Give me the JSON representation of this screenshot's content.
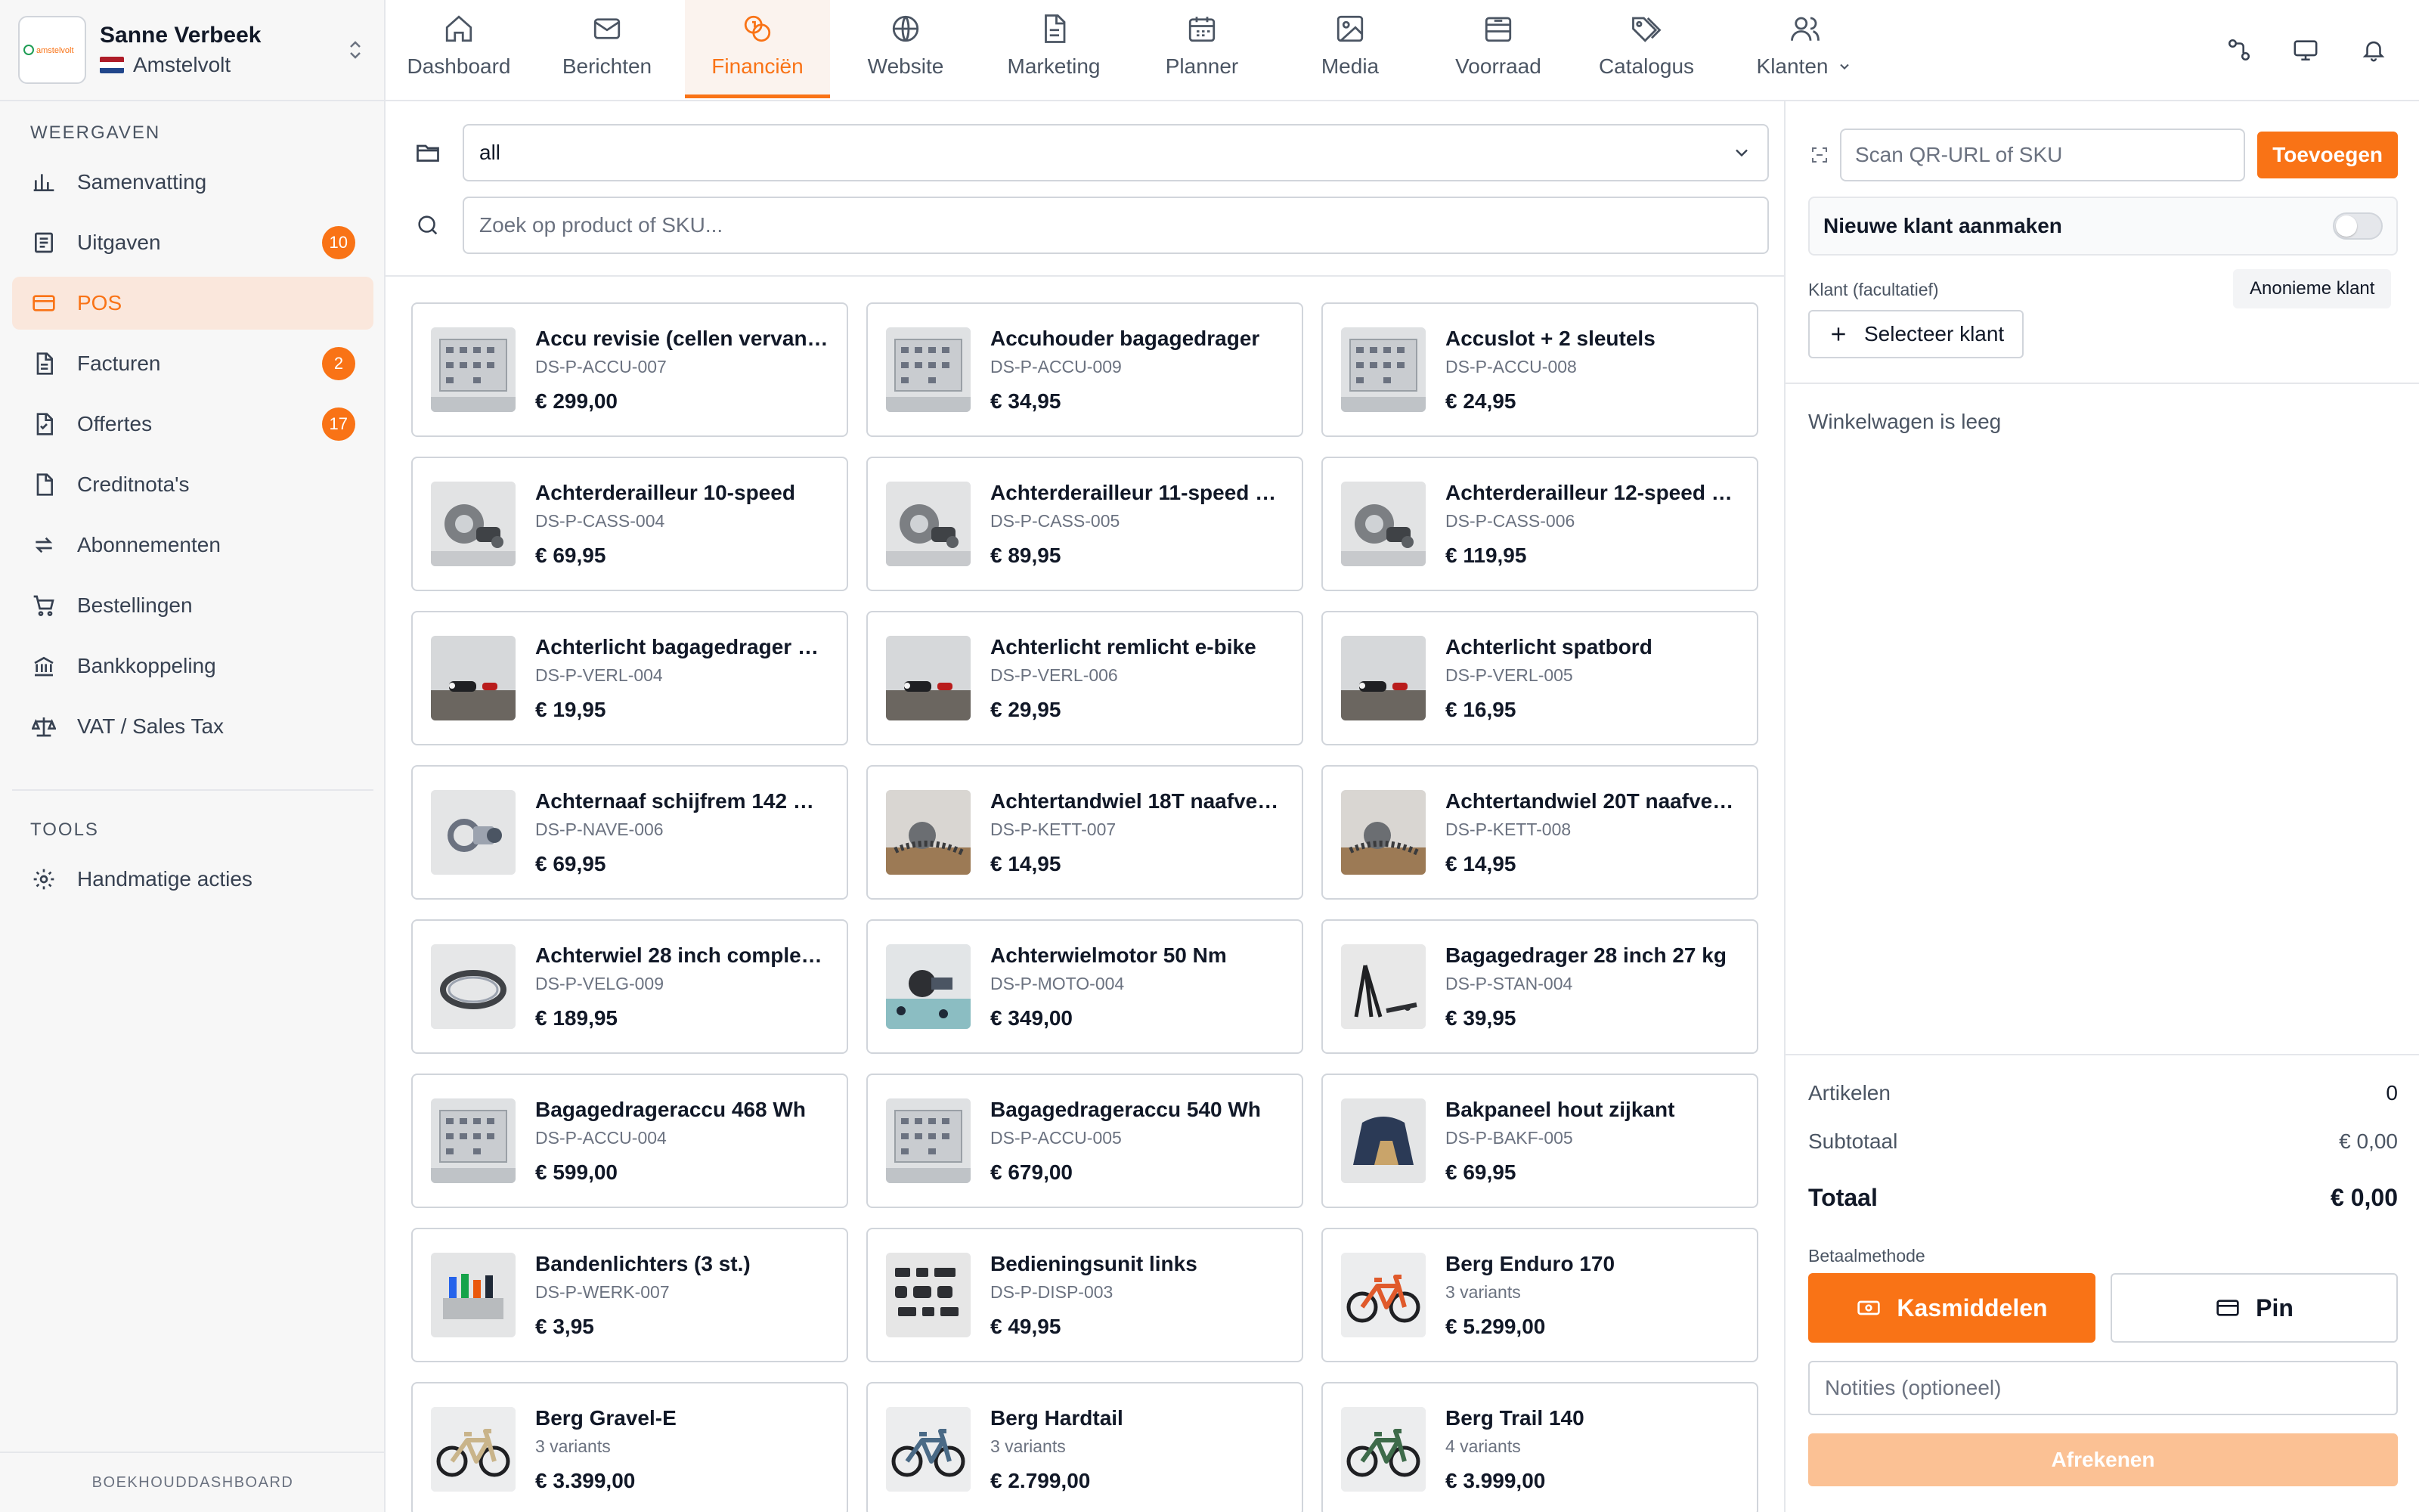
{
  "account": {
    "name": "Sanne Verbeek",
    "company": "Amstelvolt",
    "logo_text": "amstelvolt"
  },
  "sidebar": {
    "section_views": "WEERGAVEN",
    "items": [
      {
        "label": "Samenvatting",
        "icon": "bar-chart-icon",
        "badge": ""
      },
      {
        "label": "Uitgaven",
        "icon": "receipt-icon",
        "badge": "10"
      },
      {
        "label": "POS",
        "icon": "credit-card-icon",
        "badge": ""
      },
      {
        "label": "Facturen",
        "icon": "document-icon",
        "badge": "2"
      },
      {
        "label": "Offertes",
        "icon": "quote-document-icon",
        "badge": "17"
      },
      {
        "label": "Creditnota's",
        "icon": "credit-note-icon",
        "badge": ""
      },
      {
        "label": "Abonnementen",
        "icon": "repeat-icon",
        "badge": ""
      },
      {
        "label": "Bestellingen",
        "icon": "cart-icon",
        "badge": ""
      },
      {
        "label": "Bankkoppeling",
        "icon": "bank-icon",
        "badge": ""
      },
      {
        "label": "VAT / Sales Tax",
        "icon": "scales-icon",
        "badge": ""
      }
    ],
    "section_tools": "TOOLS",
    "tools": [
      {
        "label": "Handmatige acties",
        "icon": "gear-icon"
      }
    ],
    "footer": "BOEKHOUDDASHBOARD"
  },
  "topnav": {
    "tabs": [
      {
        "label": "Dashboard",
        "icon": "home-icon"
      },
      {
        "label": "Berichten",
        "icon": "mail-icon"
      },
      {
        "label": "Financiën",
        "icon": "coins-icon"
      },
      {
        "label": "Website",
        "icon": "globe-icon"
      },
      {
        "label": "Marketing",
        "icon": "document-icon"
      },
      {
        "label": "Planner",
        "icon": "calendar-icon"
      },
      {
        "label": "Media",
        "icon": "image-icon"
      },
      {
        "label": "Voorraad",
        "icon": "archive-icon"
      },
      {
        "label": "Catalogus",
        "icon": "tags-icon"
      },
      {
        "label": "Klanten",
        "icon": "users-icon"
      }
    ]
  },
  "pos": {
    "folder_select": "all",
    "search_placeholder": "Zoek op product of SKU...",
    "products": [
      {
        "name": "Accu revisie (cellen vervange...",
        "sub": "DS-P-ACCU-007",
        "price": "€ 299,00",
        "img": "rack"
      },
      {
        "name": "Accuhouder bagagedrager",
        "sub": "DS-P-ACCU-009",
        "price": "€ 34,95",
        "img": "rack"
      },
      {
        "name": "Accuslot + 2 sleutels",
        "sub": "DS-P-ACCU-008",
        "price": "€ 24,95",
        "img": "rack"
      },
      {
        "name": "Achterderailleur 10-speed",
        "sub": "DS-P-CASS-004",
        "price": "€ 69,95",
        "img": "gear"
      },
      {
        "name": "Achterderailleur 11-speed e-...",
        "sub": "DS-P-CASS-005",
        "price": "€ 89,95",
        "img": "gear"
      },
      {
        "name": "Achterderailleur 12-speed e-...",
        "sub": "DS-P-CASS-006",
        "price": "€ 119,95",
        "img": "gear"
      },
      {
        "name": "Achterlicht bagagedrager 50...",
        "sub": "DS-P-VERL-004",
        "price": "€ 19,95",
        "img": "light"
      },
      {
        "name": "Achterlicht remlicht e-bike",
        "sub": "DS-P-VERL-006",
        "price": "€ 29,95",
        "img": "light"
      },
      {
        "name": "Achterlicht spatbord",
        "sub": "DS-P-VERL-005",
        "price": "€ 16,95",
        "img": "light"
      },
      {
        "name": "Achternaaf schijfrem 142 mm",
        "sub": "DS-P-NAVE-006",
        "price": "€ 69,95",
        "img": "hub"
      },
      {
        "name": "Achtertandwiel 18T naafvers...",
        "sub": "DS-P-KETT-007",
        "price": "€ 14,95",
        "img": "chain"
      },
      {
        "name": "Achtertandwiel 20T naafvers...",
        "sub": "DS-P-KETT-008",
        "price": "€ 14,95",
        "img": "chain"
      },
      {
        "name": "Achterwiel 28 inch compleet...",
        "sub": "DS-P-VELG-009",
        "price": "€ 189,95",
        "img": "rim"
      },
      {
        "name": "Achterwielmotor 50 Nm",
        "sub": "DS-P-MOTO-004",
        "price": "€ 349,00",
        "img": "motor"
      },
      {
        "name": "Bagagedrager 28 inch 27 kg",
        "sub": "DS-P-STAN-004",
        "price": "€ 39,95",
        "img": "stand"
      },
      {
        "name": "Bagagedrageraccu 468 Wh",
        "sub": "DS-P-ACCU-004",
        "price": "€ 599,00",
        "img": "rack"
      },
      {
        "name": "Bagagedrageraccu 540 Wh",
        "sub": "DS-P-ACCU-005",
        "price": "€ 679,00",
        "img": "rack"
      },
      {
        "name": "Bakpaneel hout zijkant",
        "sub": "DS-P-BAKF-005",
        "price": "€ 69,95",
        "img": "tent"
      },
      {
        "name": "Bandenlichters (3 st.)",
        "sub": "DS-P-WERK-007",
        "price": "€ 3,95",
        "img": "tools"
      },
      {
        "name": "Bedieningsunit links",
        "sub": "DS-P-DISP-003",
        "price": "€ 49,95",
        "img": "parts"
      },
      {
        "name": "Berg Enduro 170",
        "sub": "3 variants",
        "price": "€ 5.299,00",
        "img": "bike-orange"
      },
      {
        "name": "Berg Gravel-E",
        "sub": "3 variants",
        "price": "€ 3.399,00",
        "img": "bike-beige"
      },
      {
        "name": "Berg Hardtail",
        "sub": "3 variants",
        "price": "€ 2.799,00",
        "img": "bike-blue"
      },
      {
        "name": "Berg Trail 140",
        "sub": "4 variants",
        "price": "€ 3.999,00",
        "img": "bike-green"
      }
    ]
  },
  "cart": {
    "scan_placeholder": "Scan QR-URL of SKU",
    "add_label": "Toevoegen",
    "new_customer_label": "Nieuwe klant aanmaken",
    "customer_label": "Klant (facultatief)",
    "anonymous_label": "Anonieme klant",
    "select_customer_label": "Selecteer klant",
    "empty_label": "Winkelwagen is leeg",
    "items_label": "Artikelen",
    "items_value": "0",
    "subtotal_label": "Subtotaal",
    "subtotal_value": "€ 0,00",
    "total_label": "Totaal",
    "total_value": "€ 0,00",
    "payment_label": "Betaalmethode",
    "cash_label": "Kasmiddelen",
    "pin_label": "Pin",
    "notes_placeholder": "Notities (optioneel)",
    "checkout_label": "Afrekenen"
  },
  "colors": {
    "accent": "#f97316",
    "accent_soft": "#fae7dc",
    "border": "#d1d5db"
  }
}
